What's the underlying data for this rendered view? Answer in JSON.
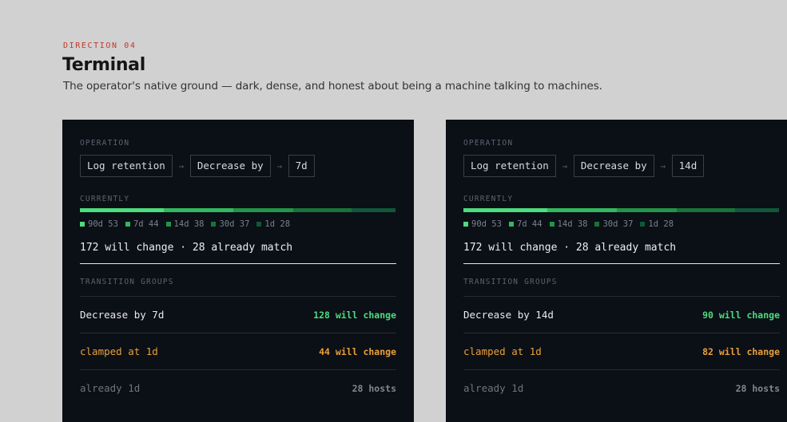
{
  "header": {
    "eyebrow": "DIRECTION 04",
    "title": "Terminal",
    "subtitle": "The operator's native ground — dark, dense, and honest about being a machine talking to machines."
  },
  "colors": {
    "accent_red": "#c0392b",
    "panel_bg": "#0b0f16",
    "green": "#4ddc7e",
    "amber": "#e8a03a"
  },
  "panels": [
    {
      "operation_label": "OPERATION",
      "chips": [
        "Log retention",
        "Decrease by",
        "7d"
      ],
      "arrow": "→",
      "currently_label": "CURRENTLY",
      "legend": [
        {
          "label": "90d 53",
          "value": 53,
          "color": "#4ddc7e"
        },
        {
          "label": "7d 44",
          "value": 44,
          "color": "#33b85f"
        },
        {
          "label": "14d 38",
          "value": 38,
          "color": "#239447"
        },
        {
          "label": "30d 37",
          "value": 37,
          "color": "#197338"
        },
        {
          "label": "1d 28",
          "value": 28,
          "color": "#10573a"
        }
      ],
      "summary": "172 will change · 28 already match",
      "groups_label": "TRANSITION GROUPS",
      "groups": [
        {
          "name": "Decrease by 7d",
          "count": "128 will change",
          "tone": "green"
        },
        {
          "name": "clamped at 1d",
          "count": "44 will change",
          "tone": "amber"
        },
        {
          "name": "already 1d",
          "count": "28 hosts",
          "tone": "dim"
        }
      ]
    },
    {
      "operation_label": "OPERATION",
      "chips": [
        "Log retention",
        "Decrease by",
        "14d"
      ],
      "arrow": "→",
      "currently_label": "CURRENTLY",
      "legend": [
        {
          "label": "90d 53",
          "value": 53,
          "color": "#4ddc7e"
        },
        {
          "label": "7d 44",
          "value": 44,
          "color": "#33b85f"
        },
        {
          "label": "14d 38",
          "value": 38,
          "color": "#239447"
        },
        {
          "label": "30d 37",
          "value": 37,
          "color": "#197338"
        },
        {
          "label": "1d 28",
          "value": 28,
          "color": "#10573a"
        }
      ],
      "summary": "172 will change · 28 already match",
      "groups_label": "TRANSITION GROUPS",
      "groups": [
        {
          "name": "Decrease by 14d",
          "count": "90 will change",
          "tone": "green"
        },
        {
          "name": "clamped at 1d",
          "count": "82 will change",
          "tone": "amber"
        },
        {
          "name": "already 1d",
          "count": "28 hosts",
          "tone": "dim"
        }
      ]
    }
  ]
}
